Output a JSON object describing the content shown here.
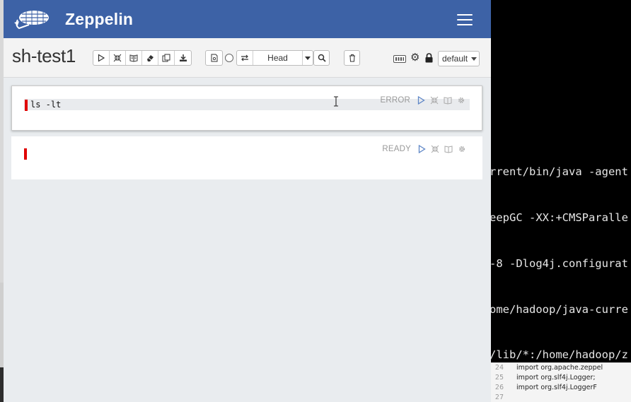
{
  "app": {
    "brand": "Zeppelin",
    "notebook_title": "sh-test1"
  },
  "toolbar": {
    "actions": [
      {
        "icon": "play-icon"
      },
      {
        "icon": "collapse-icon"
      },
      {
        "icon": "book-icon"
      },
      {
        "icon": "eraser-icon"
      },
      {
        "icon": "copy-icon"
      },
      {
        "icon": "download-icon"
      }
    ],
    "version_icons": [
      "commit-icon",
      "circle-icon"
    ],
    "compare_icon": "swap-icon",
    "head_label": "Head",
    "search_icon": "search-icon",
    "trash_icon": "trash-icon",
    "keyboard_icon": "keyboard-icon",
    "settings_icon": "gear-icon",
    "lock_icon": "lock-icon",
    "interpreter_label": "default"
  },
  "paragraphs": [
    {
      "code": "ls -lt",
      "status": "ERROR"
    },
    {
      "code": "",
      "status": "READY"
    }
  ],
  "terminal": {
    "lines": [
      "rrent/bin/java -agent",
      "eepGC -XX:+CMSParalle",
      "-8 -Dlog4j.configurat",
      "ome/hadoop/java-curre",
      "/lib/*:/home/hadoop/z"
    ]
  },
  "code_editor": {
    "lines": [
      {
        "num": "24",
        "text": "import org.apache.zeppel"
      },
      {
        "num": "25",
        "text": "import org.slf4j.Logger;"
      },
      {
        "num": "26",
        "text": "import org.slf4j.LoggerF"
      },
      {
        "num": "27",
        "text": ""
      }
    ]
  },
  "colors": {
    "navbar": "#3d62a6",
    "error_marker": "#e00000"
  }
}
